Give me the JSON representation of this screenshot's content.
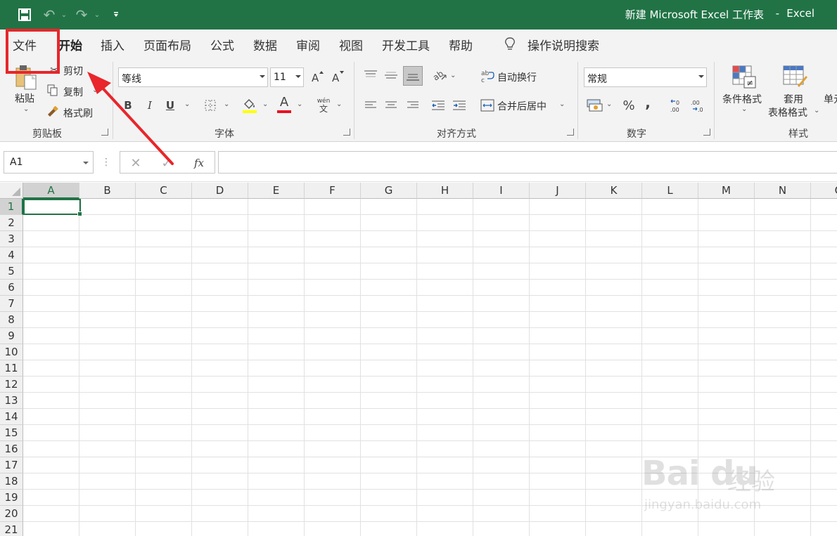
{
  "titlebar": {
    "title": "新建 Microsoft Excel 工作表",
    "separator": "-",
    "app": "Excel",
    "bg_color": "#217346"
  },
  "tabs": [
    "文件",
    "开始",
    "插入",
    "页面布局",
    "公式",
    "数据",
    "审阅",
    "视图",
    "开发工具",
    "帮助"
  ],
  "active_tab": "开始",
  "tell_me": "操作说明搜索",
  "clipboard": {
    "paste": "粘贴",
    "cut": "剪切",
    "copy": "复制",
    "format_painter": "格式刷",
    "group": "剪贴板"
  },
  "font": {
    "name": "等线",
    "size": "11",
    "group": "字体",
    "bold": "B",
    "italic": "I",
    "underline": "U",
    "font_color_letter": "A",
    "phonetic_top": "wén",
    "phonetic_bottom": "文"
  },
  "alignment": {
    "wrap": "自动换行",
    "merge": "合并后居中",
    "group": "对齐方式"
  },
  "number": {
    "format": "常规",
    "percent": "%",
    "comma": ",",
    "group": "数字"
  },
  "styles": {
    "conditional_line1": "条件格式",
    "table_line1": "套用",
    "table_line2": "表格格式",
    "cell_styles": "单元",
    "group": "样式"
  },
  "formula_bar": {
    "name_box": "A1",
    "fx": "fx",
    "formula": ""
  },
  "grid": {
    "columns": [
      "A",
      "B",
      "C",
      "D",
      "E",
      "F",
      "G",
      "H",
      "I",
      "J",
      "K",
      "L",
      "M",
      "N",
      "O"
    ],
    "rows": [
      "1",
      "2",
      "3",
      "4",
      "5",
      "6",
      "7",
      "8",
      "9",
      "10",
      "11",
      "12",
      "13",
      "14",
      "15",
      "16",
      "17",
      "18",
      "19",
      "20",
      "21"
    ],
    "selected": "A1",
    "accent": "#217346"
  },
  "annotation": {
    "color": "#e8262b"
  },
  "watermark": {
    "logo": "Bai du",
    "cn": "经验",
    "url": "jingyan.baidu.com"
  }
}
